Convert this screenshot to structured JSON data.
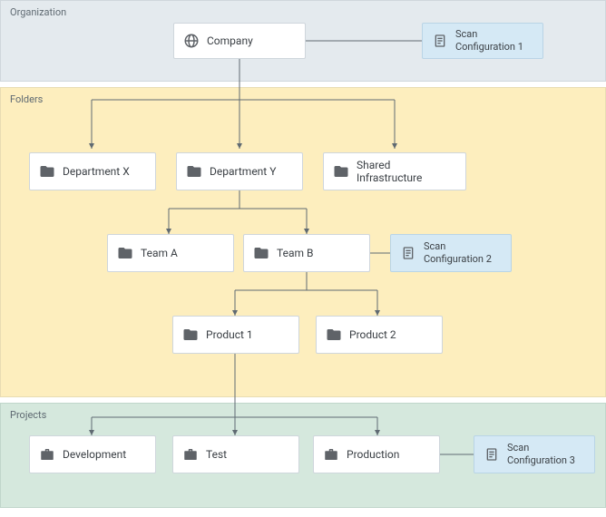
{
  "sections": {
    "organization": "Organization",
    "folders": "Folders",
    "projects": "Projects"
  },
  "nodes": {
    "company": "Company",
    "dept_x": "Department X",
    "dept_y": "Department Y",
    "shared": "Shared Infrastructure",
    "team_a": "Team A",
    "team_b": "Team B",
    "product_1": "Product 1",
    "product_2": "Product 2",
    "dev": "Development",
    "test": "Test",
    "prod": "Production"
  },
  "scans": {
    "s1a": "Scan",
    "s1b": "Configuration 1",
    "s2a": "Scan",
    "s2b": "Configuration 2",
    "s3a": "Scan",
    "s3b": "Configuration 3"
  },
  "colors": {
    "org_bg": "#e4eaee",
    "folders_bg": "#fdeebe",
    "projects_bg": "#d5e8dd",
    "scan_bg": "#d5e9f5",
    "node_border": "#cfd6dc",
    "icon": "#5f6368",
    "line": "#5f6a72"
  }
}
